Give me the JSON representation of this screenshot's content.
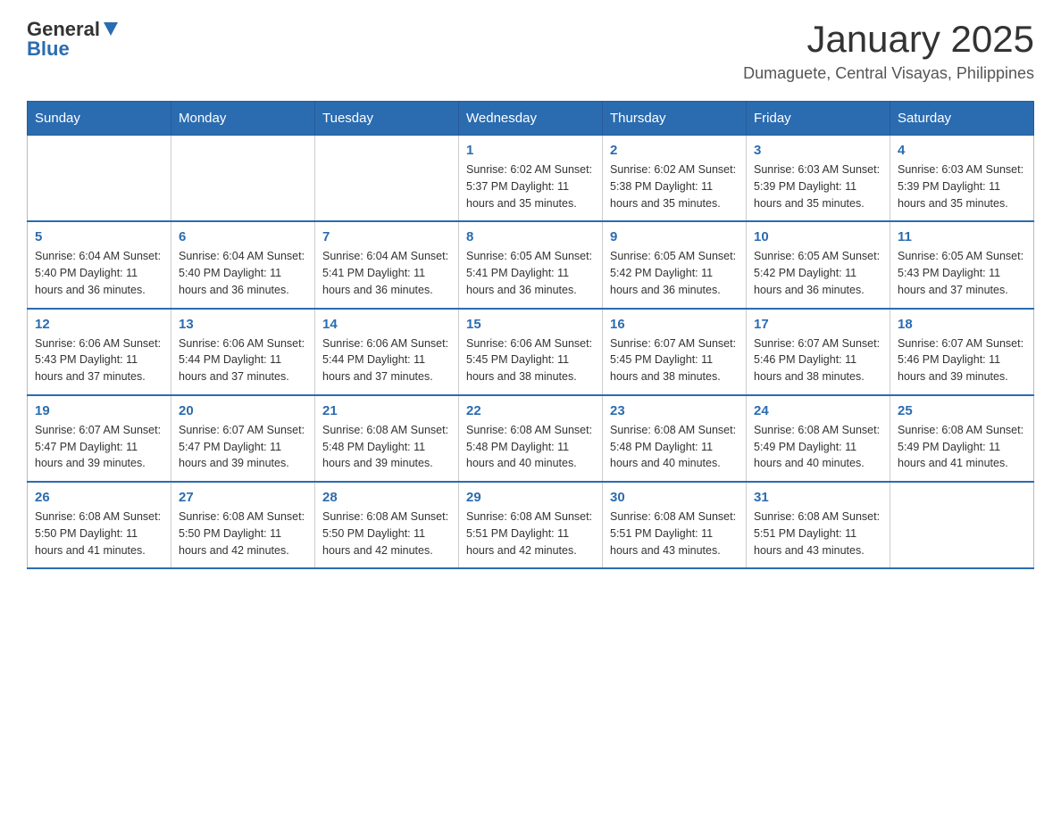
{
  "logo": {
    "text_general": "General",
    "text_blue": "Blue"
  },
  "header": {
    "title": "January 2025",
    "subtitle": "Dumaguete, Central Visayas, Philippines"
  },
  "days_of_week": [
    "Sunday",
    "Monday",
    "Tuesday",
    "Wednesday",
    "Thursday",
    "Friday",
    "Saturday"
  ],
  "weeks": [
    [
      {
        "day": "",
        "info": ""
      },
      {
        "day": "",
        "info": ""
      },
      {
        "day": "",
        "info": ""
      },
      {
        "day": "1",
        "info": "Sunrise: 6:02 AM\nSunset: 5:37 PM\nDaylight: 11 hours and 35 minutes."
      },
      {
        "day": "2",
        "info": "Sunrise: 6:02 AM\nSunset: 5:38 PM\nDaylight: 11 hours and 35 minutes."
      },
      {
        "day": "3",
        "info": "Sunrise: 6:03 AM\nSunset: 5:39 PM\nDaylight: 11 hours and 35 minutes."
      },
      {
        "day": "4",
        "info": "Sunrise: 6:03 AM\nSunset: 5:39 PM\nDaylight: 11 hours and 35 minutes."
      }
    ],
    [
      {
        "day": "5",
        "info": "Sunrise: 6:04 AM\nSunset: 5:40 PM\nDaylight: 11 hours and 36 minutes."
      },
      {
        "day": "6",
        "info": "Sunrise: 6:04 AM\nSunset: 5:40 PM\nDaylight: 11 hours and 36 minutes."
      },
      {
        "day": "7",
        "info": "Sunrise: 6:04 AM\nSunset: 5:41 PM\nDaylight: 11 hours and 36 minutes."
      },
      {
        "day": "8",
        "info": "Sunrise: 6:05 AM\nSunset: 5:41 PM\nDaylight: 11 hours and 36 minutes."
      },
      {
        "day": "9",
        "info": "Sunrise: 6:05 AM\nSunset: 5:42 PM\nDaylight: 11 hours and 36 minutes."
      },
      {
        "day": "10",
        "info": "Sunrise: 6:05 AM\nSunset: 5:42 PM\nDaylight: 11 hours and 36 minutes."
      },
      {
        "day": "11",
        "info": "Sunrise: 6:05 AM\nSunset: 5:43 PM\nDaylight: 11 hours and 37 minutes."
      }
    ],
    [
      {
        "day": "12",
        "info": "Sunrise: 6:06 AM\nSunset: 5:43 PM\nDaylight: 11 hours and 37 minutes."
      },
      {
        "day": "13",
        "info": "Sunrise: 6:06 AM\nSunset: 5:44 PM\nDaylight: 11 hours and 37 minutes."
      },
      {
        "day": "14",
        "info": "Sunrise: 6:06 AM\nSunset: 5:44 PM\nDaylight: 11 hours and 37 minutes."
      },
      {
        "day": "15",
        "info": "Sunrise: 6:06 AM\nSunset: 5:45 PM\nDaylight: 11 hours and 38 minutes."
      },
      {
        "day": "16",
        "info": "Sunrise: 6:07 AM\nSunset: 5:45 PM\nDaylight: 11 hours and 38 minutes."
      },
      {
        "day": "17",
        "info": "Sunrise: 6:07 AM\nSunset: 5:46 PM\nDaylight: 11 hours and 38 minutes."
      },
      {
        "day": "18",
        "info": "Sunrise: 6:07 AM\nSunset: 5:46 PM\nDaylight: 11 hours and 39 minutes."
      }
    ],
    [
      {
        "day": "19",
        "info": "Sunrise: 6:07 AM\nSunset: 5:47 PM\nDaylight: 11 hours and 39 minutes."
      },
      {
        "day": "20",
        "info": "Sunrise: 6:07 AM\nSunset: 5:47 PM\nDaylight: 11 hours and 39 minutes."
      },
      {
        "day": "21",
        "info": "Sunrise: 6:08 AM\nSunset: 5:48 PM\nDaylight: 11 hours and 39 minutes."
      },
      {
        "day": "22",
        "info": "Sunrise: 6:08 AM\nSunset: 5:48 PM\nDaylight: 11 hours and 40 minutes."
      },
      {
        "day": "23",
        "info": "Sunrise: 6:08 AM\nSunset: 5:48 PM\nDaylight: 11 hours and 40 minutes."
      },
      {
        "day": "24",
        "info": "Sunrise: 6:08 AM\nSunset: 5:49 PM\nDaylight: 11 hours and 40 minutes."
      },
      {
        "day": "25",
        "info": "Sunrise: 6:08 AM\nSunset: 5:49 PM\nDaylight: 11 hours and 41 minutes."
      }
    ],
    [
      {
        "day": "26",
        "info": "Sunrise: 6:08 AM\nSunset: 5:50 PM\nDaylight: 11 hours and 41 minutes."
      },
      {
        "day": "27",
        "info": "Sunrise: 6:08 AM\nSunset: 5:50 PM\nDaylight: 11 hours and 42 minutes."
      },
      {
        "day": "28",
        "info": "Sunrise: 6:08 AM\nSunset: 5:50 PM\nDaylight: 11 hours and 42 minutes."
      },
      {
        "day": "29",
        "info": "Sunrise: 6:08 AM\nSunset: 5:51 PM\nDaylight: 11 hours and 42 minutes."
      },
      {
        "day": "30",
        "info": "Sunrise: 6:08 AM\nSunset: 5:51 PM\nDaylight: 11 hours and 43 minutes."
      },
      {
        "day": "31",
        "info": "Sunrise: 6:08 AM\nSunset: 5:51 PM\nDaylight: 11 hours and 43 minutes."
      },
      {
        "day": "",
        "info": ""
      }
    ]
  ]
}
